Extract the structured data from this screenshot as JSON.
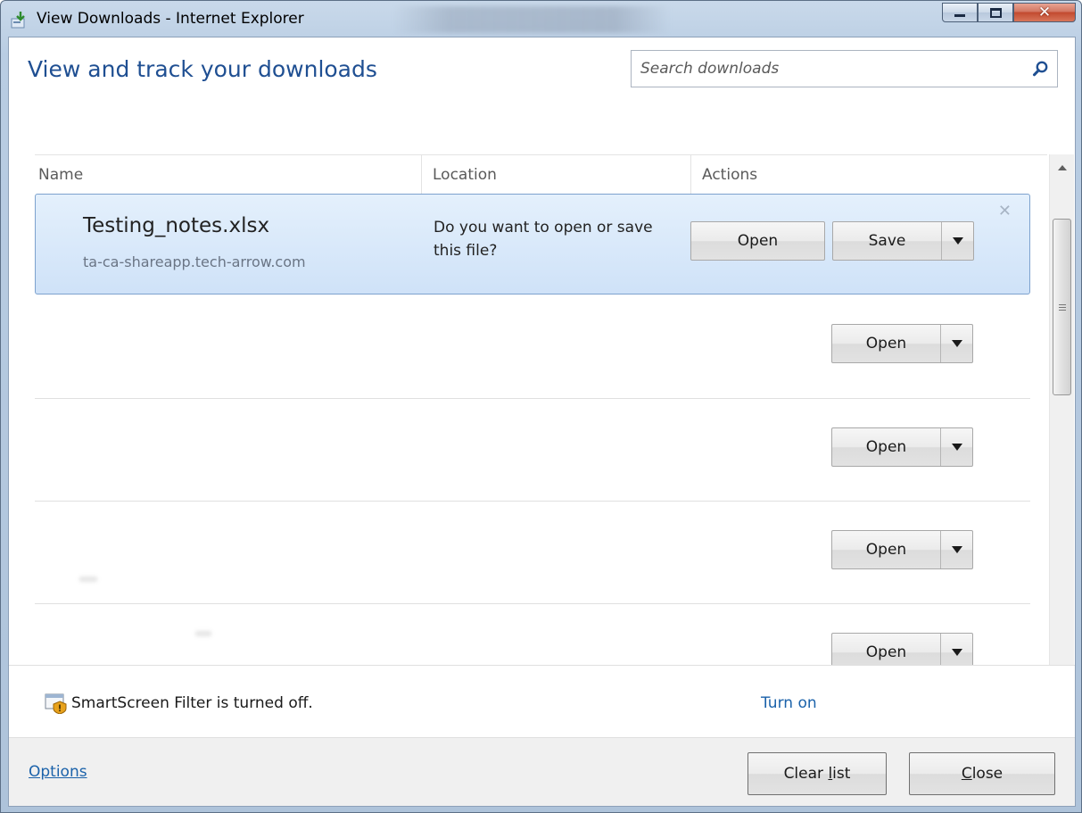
{
  "window": {
    "title": "View Downloads - Internet Explorer",
    "title_icon": "downloads-icon",
    "caption_buttons": [
      "minimize",
      "maximize",
      "close"
    ]
  },
  "header": {
    "title": "View and track your downloads",
    "search_placeholder": "Search downloads",
    "search_icon": "search-icon"
  },
  "columns": {
    "name": "Name",
    "location": "Location",
    "actions": "Actions"
  },
  "downloads": [
    {
      "file_name": "Testing_notes.xlsx",
      "source": "ta-ca-shareapp.tech-arrow.com",
      "location_text": "Do you want to open or save this file?",
      "open_label": "Open",
      "save_label": "Save",
      "selected": true
    },
    {
      "open_label": "Open"
    },
    {
      "open_label": "Open"
    },
    {
      "open_label": "Open"
    },
    {
      "open_label": "Open"
    }
  ],
  "smartscreen": {
    "message": "SmartScreen Filter is turned off.",
    "action": "Turn on",
    "icon": "shield-warning-icon"
  },
  "footer": {
    "options": "Options",
    "clear_list_pre": "Clear ",
    "clear_list_key": "l",
    "clear_list_post": "ist",
    "close_key": "C",
    "close_post": "lose"
  },
  "colors": {
    "accent_title": "#1f4f92",
    "link": "#1b62aa",
    "selected_row": "#d4e6fa"
  }
}
